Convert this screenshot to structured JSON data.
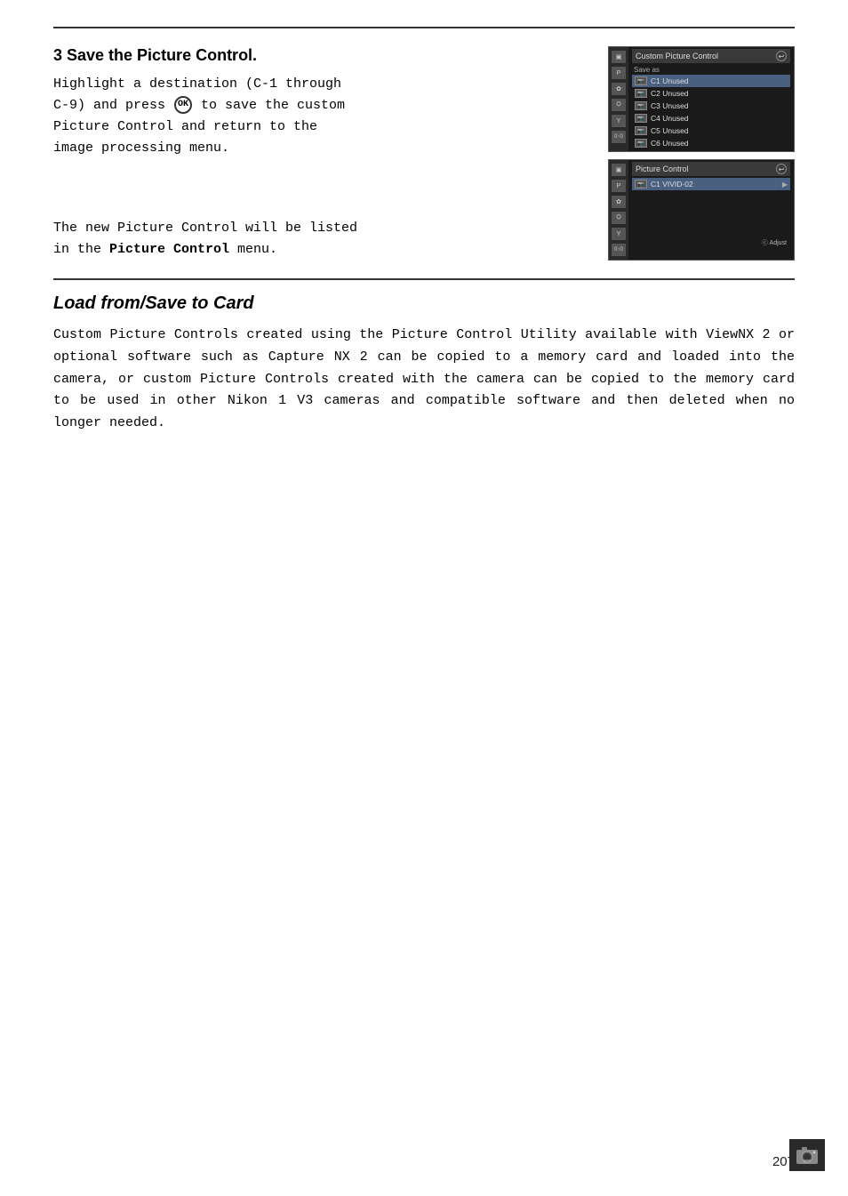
{
  "page": {
    "number": "207"
  },
  "step3": {
    "heading": "3 Save the Picture Control.",
    "body": "Highlight a destination (C-1 through\nC-9) and press Ⓢ to save the custom\nPicture Control and return to the\nimage processing menu.",
    "note": "The new Picture Control will be listed\nin the ",
    "note_bold": "Picture Control",
    "note_end": " menu."
  },
  "custom_picture_control_panel": {
    "title": "Custom Picture Control",
    "subtitle": "Save as",
    "items": [
      {
        "label": "⎂C1 Unused",
        "highlighted": true
      },
      {
        "label": "⎂C2 Unused",
        "highlighted": false
      },
      {
        "label": "⎂C3 Unused",
        "highlighted": false
      },
      {
        "label": "⎂C4 Unused",
        "highlighted": false
      },
      {
        "label": "⎂C5 Unused",
        "highlighted": false
      },
      {
        "label": "⎂C6 Unused",
        "highlighted": false
      }
    ]
  },
  "picture_control_panel": {
    "title": "Picture Control",
    "items": [
      {
        "label": "⎂C1 VIVID-02",
        "highlighted": true,
        "has_arrow": true
      }
    ],
    "adjust_label": "ⓒ Adjust"
  },
  "load_save": {
    "heading": "Load from/Save to Card",
    "body": "Custom Picture Controls created using the Picture Control Utility available with ViewNX 2 or optional software such as Capture NX 2 can be copied to a memory card and loaded into the camera, or custom Picture Controls created with the camera can be copied to the memory card to be used in other Nikon 1 V3 cameras and compatible software and then deleted when no longer needed."
  },
  "sidebar_icons": [
    "▣",
    "P",
    "✿",
    "⛭",
    "Y",
    "0+0"
  ],
  "sidebar_icons_bottom": [
    "▣",
    "P",
    "✿",
    "⛭",
    "Y",
    "0+0"
  ]
}
